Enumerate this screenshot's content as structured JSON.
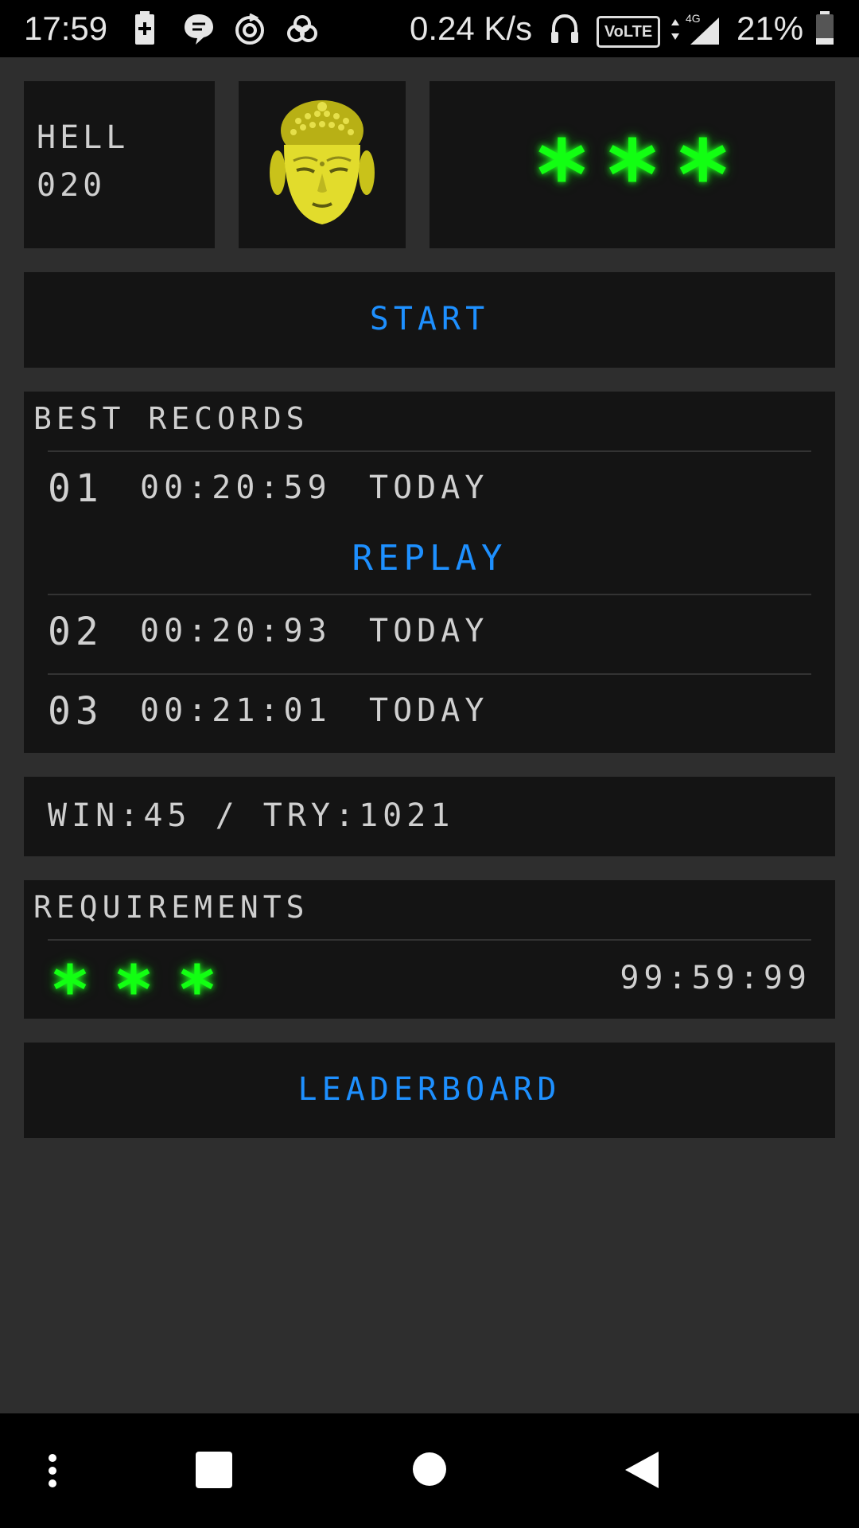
{
  "status_bar": {
    "time": "17:59",
    "network_speed": "0.24 K/s",
    "volte": "VoLTE",
    "network_type": "4G",
    "battery_percent": "21%",
    "icons": [
      "battery-plus-icon",
      "message-icon",
      "sync-icon",
      "cloud-icon",
      "headphones-icon",
      "data-arrows-icon",
      "signal-icon",
      "battery-icon"
    ]
  },
  "level": {
    "difficulty": "HELL",
    "number": "020",
    "avatar": "buddha-head-icon",
    "stars": [
      "*",
      "*",
      "*"
    ]
  },
  "start_button": {
    "label": "START"
  },
  "best_records": {
    "title": "BEST RECORDS",
    "replay_label": "REPLAY",
    "records": [
      {
        "rank": "01",
        "time": "00:20:59",
        "day": "TODAY"
      },
      {
        "rank": "02",
        "time": "00:20:93",
        "day": "TODAY"
      },
      {
        "rank": "03",
        "time": "00:21:01",
        "day": "TODAY"
      }
    ]
  },
  "stats": {
    "text": "WIN:45 / TRY:1021"
  },
  "requirements": {
    "title": "REQUIREMENTS",
    "stars": [
      "*",
      "*",
      "*"
    ],
    "time": "99:59:99"
  },
  "leaderboard_button": {
    "label": "LEADERBOARD"
  },
  "nav_bar": {
    "icons": [
      "menu-dots-icon",
      "recents-icon",
      "home-icon",
      "back-icon"
    ]
  },
  "colors": {
    "background": "#2e2e2e",
    "panel": "#141414",
    "accent_blue": "#1e90ff",
    "star_green": "#12ff12",
    "text_gray": "#cfcfcf"
  }
}
